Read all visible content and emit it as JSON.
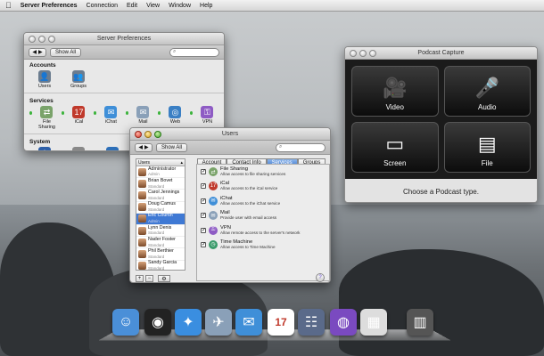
{
  "menubar": {
    "apple": "",
    "items": [
      "Server Preferences",
      "Connection",
      "Edit",
      "View",
      "Window",
      "Help"
    ]
  },
  "server_prefs": {
    "title": "Server Preferences",
    "show_all": "Show All",
    "sections": [
      {
        "title": "Accounts",
        "items": [
          {
            "label": "Users",
            "icon": "users-icon",
            "color": "#6b7c8f"
          },
          {
            "label": "Groups",
            "icon": "groups-icon",
            "color": "#6b7c8f"
          }
        ]
      },
      {
        "title": "Services",
        "items": [
          {
            "label": "File Sharing",
            "icon": "file-sharing-icon",
            "color": "#7aa36a"
          },
          {
            "label": "iCal",
            "icon": "ical-icon",
            "color": "#c0392b"
          },
          {
            "label": "iChat",
            "icon": "ichat-icon",
            "color": "#3f8fd8"
          },
          {
            "label": "Mail",
            "icon": "mail-icon",
            "color": "#8aa0b8"
          },
          {
            "label": "Web",
            "icon": "web-icon",
            "color": "#3a7fc4"
          },
          {
            "label": "VPN",
            "icon": "vpn-icon",
            "color": "#8e5bc4"
          }
        ]
      },
      {
        "title": "System",
        "items": [
          {
            "label": "Information",
            "icon": "information-icon",
            "color": "#2d5fa8"
          },
          {
            "label": "Logs",
            "icon": "logs-icon",
            "color": "#888888"
          },
          {
            "label": "Graphs",
            "icon": "graphs-icon",
            "color": "#2d6fb8"
          }
        ]
      }
    ]
  },
  "podcast": {
    "title": "Podcast Capture",
    "tiles": [
      {
        "label": "Video",
        "icon": "video-camera-icon"
      },
      {
        "label": "Audio",
        "icon": "microphone-icon"
      },
      {
        "label": "Screen",
        "icon": "screen-icon"
      },
      {
        "label": "File",
        "icon": "file-icon"
      }
    ],
    "footer": "Choose a Podcast type."
  },
  "users": {
    "title": "Users",
    "show_all": "Show All",
    "list_header": "Users",
    "tabs": [
      "Account",
      "Contact Info",
      "Services",
      "Groups"
    ],
    "selected_tab": "Services",
    "users": [
      {
        "name": "Administrator",
        "role": "Admin"
      },
      {
        "name": "Brian Bovet",
        "role": "Standard"
      },
      {
        "name": "Carol Jennings",
        "role": "Standard"
      },
      {
        "name": "Doug Camus",
        "role": "Standard"
      },
      {
        "name": "Eric Courtin",
        "role": "Admin",
        "selected": true
      },
      {
        "name": "Lynn Denis",
        "role": "Standard"
      },
      {
        "name": "Nader Foster",
        "role": "Standard"
      },
      {
        "name": "Phil Berthier",
        "role": "Standard"
      },
      {
        "name": "Sandy Garcia",
        "role": "Standard"
      }
    ],
    "services": [
      {
        "name": "File Sharing",
        "desc": "Allow access to file sharing services",
        "checked": true,
        "icon": "file-sharing-icon",
        "color": "#7aa36a"
      },
      {
        "name": "iCal",
        "desc": "Allow access to the iCal service",
        "checked": true,
        "icon": "ical-icon",
        "color": "#c0392b"
      },
      {
        "name": "iChat",
        "desc": "Allow access to the iChat service",
        "checked": true,
        "icon": "ichat-icon",
        "color": "#3f8fd8"
      },
      {
        "name": "Mail",
        "desc": "Provide user with email access",
        "checked": true,
        "icon": "mail-icon",
        "color": "#8aa0b8"
      },
      {
        "name": "VPN",
        "desc": "Allow remote access to the server's network",
        "checked": true,
        "icon": "vpn-icon",
        "color": "#8e5bc4"
      },
      {
        "name": "Time Machine",
        "desc": "Allow access to Time Machine",
        "checked": true,
        "icon": "time-machine-icon",
        "color": "#3a9a6a"
      }
    ],
    "ical_date": "17"
  },
  "dock": {
    "items": [
      {
        "icon": "finder-icon",
        "color": "#4a8fd8"
      },
      {
        "icon": "dashboard-icon",
        "color": "#222222"
      },
      {
        "icon": "safari-icon",
        "color": "#3a8ee0"
      },
      {
        "icon": "mail-stamp-icon",
        "color": "#8aa0b8"
      },
      {
        "icon": "ichat-icon",
        "color": "#3f8fd8"
      },
      {
        "icon": "ical-icon",
        "color": "#ffffff"
      },
      {
        "icon": "address-book-icon",
        "color": "#5a6a8a"
      },
      {
        "icon": "podcast-capture-icon",
        "color": "#7a4ac0"
      },
      {
        "icon": "preview-icon",
        "color": "#dddddd"
      },
      {
        "icon": "trash-icon",
        "color": "#555555"
      }
    ]
  }
}
